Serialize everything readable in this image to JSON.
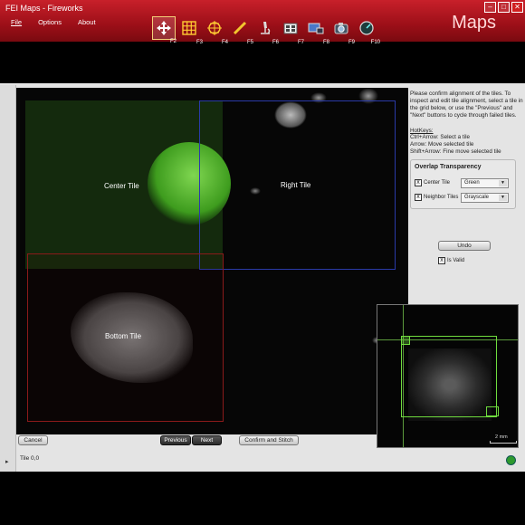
{
  "window": {
    "title": "FEI Maps - Fireworks",
    "brand": "Maps"
  },
  "menu": [
    "File",
    "Options",
    "About"
  ],
  "window_controls": [
    "–",
    "□",
    "✕"
  ],
  "toolbar": [
    {
      "icon": "move-arrows-icon",
      "fkey": "F2",
      "active": true
    },
    {
      "icon": "grid-icon",
      "fkey": "F3",
      "active": false
    },
    {
      "icon": "crosshair-grid-icon",
      "fkey": "F4",
      "active": false
    },
    {
      "icon": "ruler-icon",
      "fkey": "F5",
      "active": false
    },
    {
      "icon": "microscope-icon",
      "fkey": "F6",
      "active": false
    },
    {
      "icon": "film-icon",
      "fkey": "F7",
      "active": false
    },
    {
      "icon": "screen-icon",
      "fkey": "F8",
      "active": false
    },
    {
      "icon": "camera-icon",
      "fkey": "F9",
      "active": false
    },
    {
      "icon": "gauge-icon",
      "fkey": "F10",
      "active": false
    }
  ],
  "tiles": {
    "center": "Center Tile",
    "right": "Right Tile",
    "bottom": "Bottom Tile"
  },
  "panel": {
    "help": "Please confirm alignment of the tiles. To inspect and edit tile alignment, select a tile in the grid below, or use the \"Previous\" and \"Next\" buttons to cycle through failed tiles.",
    "hotkeys_heading": "HotKeys:",
    "hotkeys": [
      "Ctrl+Arrow: Select a tile",
      "Arrow: Move selected tile",
      "Shift+Arrow: Fine move selected tile"
    ],
    "overlap": {
      "title": "Overlap Transparency",
      "rows": [
        {
          "label": "Center Tile",
          "checked": "x",
          "value": "Green"
        },
        {
          "label": "Neighbor Tiles",
          "checked": "x",
          "value": "Grayscale"
        }
      ]
    },
    "undo": "Undo",
    "is_valid": "Is Valid",
    "is_valid_checked": "x"
  },
  "buttons": {
    "cancel": "Cancel",
    "previous": "Previous",
    "next": "Next",
    "confirm": "Confirm and Stitch"
  },
  "overview": {
    "scale": "2 mm"
  },
  "status": {
    "text": "Tile 0,0",
    "expander": "▸"
  },
  "colors": {
    "accent": "#b3141e",
    "center_overlay": "#3a8a1f",
    "right_border": "#2a3aa8",
    "bottom_border": "#8a1a1a"
  }
}
